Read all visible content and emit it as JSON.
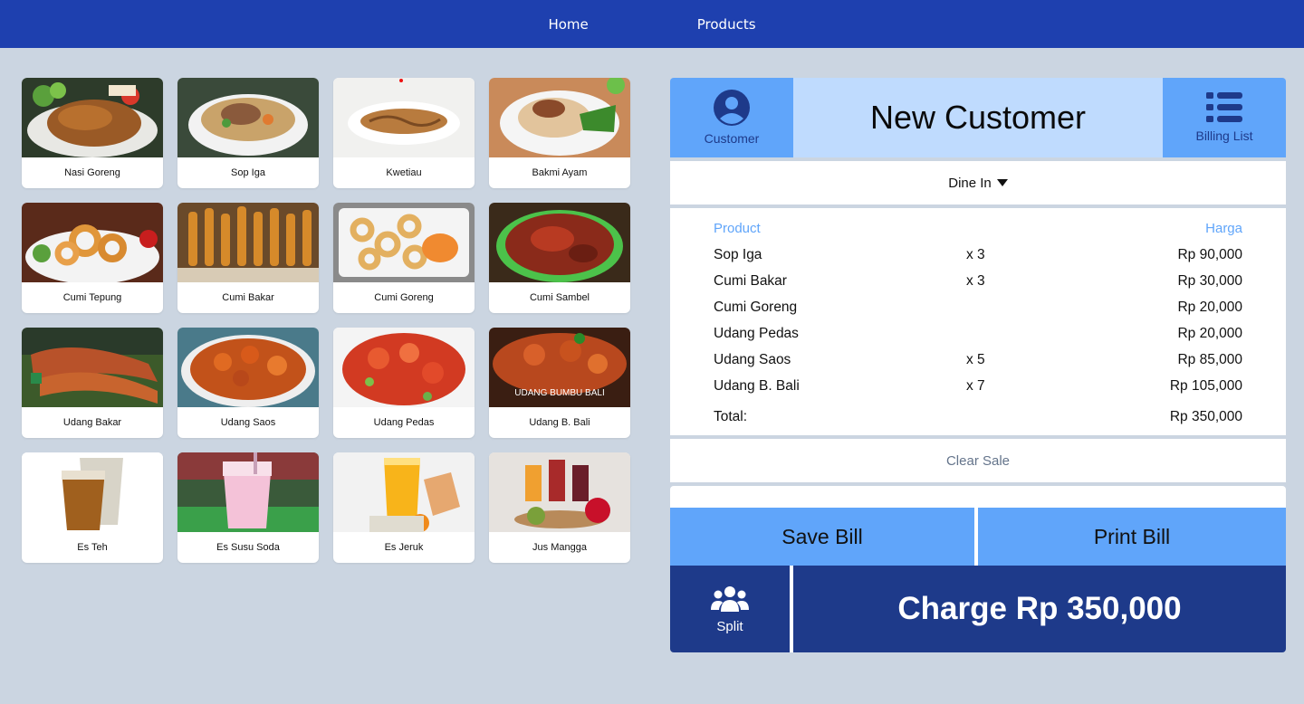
{
  "nav": {
    "home": "Home",
    "products": "Products"
  },
  "products": [
    {
      "name": "Nasi Goreng",
      "thumb": "fried-rice"
    },
    {
      "name": "Sop Iga",
      "thumb": "soup"
    },
    {
      "name": "Kwetiau",
      "thumb": "noodles"
    },
    {
      "name": "Bakmi Ayam",
      "thumb": "noodle-bowl"
    },
    {
      "name": "Cumi Tepung",
      "thumb": "squid-rings"
    },
    {
      "name": "Cumi Bakar",
      "thumb": "skewers"
    },
    {
      "name": "Cumi Goreng",
      "thumb": "squid-rings-plate"
    },
    {
      "name": "Cumi Sambel",
      "thumb": "squid-sambal"
    },
    {
      "name": "Udang Bakar",
      "thumb": "grilled-shrimp"
    },
    {
      "name": "Udang Saos",
      "thumb": "shrimp-sauce"
    },
    {
      "name": "Udang Pedas",
      "thumb": "spicy-shrimp"
    },
    {
      "name": "Udang B. Bali",
      "thumb": "bali-shrimp",
      "overlay": "UDANG BUMBU BALI"
    },
    {
      "name": "Es Teh",
      "thumb": "iced-tea"
    },
    {
      "name": "Es Susu Soda",
      "thumb": "milk-soda"
    },
    {
      "name": "Es Jeruk",
      "thumb": "orange-juice"
    },
    {
      "name": "Jus Mangga",
      "thumb": "juices"
    }
  ],
  "customer": {
    "button_label": "Customer",
    "title": "New Customer",
    "billing_label": "Billing List"
  },
  "dine": {
    "selected": "Dine In"
  },
  "bill": {
    "col_product": "Product",
    "col_harga": "Harga",
    "items": [
      {
        "name": "Sop Iga",
        "qty": "x 3",
        "price": "Rp 90,000"
      },
      {
        "name": "Cumi Bakar",
        "qty": "x 3",
        "price": "Rp 30,000"
      },
      {
        "name": "Cumi Goreng",
        "qty": "",
        "price": "Rp 20,000"
      },
      {
        "name": "Udang Pedas",
        "qty": "",
        "price": "Rp 20,000"
      },
      {
        "name": "Udang Saos",
        "qty": "x 5",
        "price": "Rp 85,000"
      },
      {
        "name": "Udang B. Bali",
        "qty": "x 7",
        "price": "Rp 105,000"
      }
    ],
    "total_label": "Total:",
    "total_value": "Rp 350,000"
  },
  "actions": {
    "clear": "Clear Sale",
    "save": "Save Bill",
    "print": "Print Bill",
    "split": "Split",
    "charge": "Charge Rp 350,000"
  },
  "colors": {
    "nav": "#1e40af",
    "accent_light": "#60a5fa",
    "accent_pale": "#bfdbfe",
    "accent_dark": "#1e3a8a",
    "background": "#cbd5e1"
  }
}
